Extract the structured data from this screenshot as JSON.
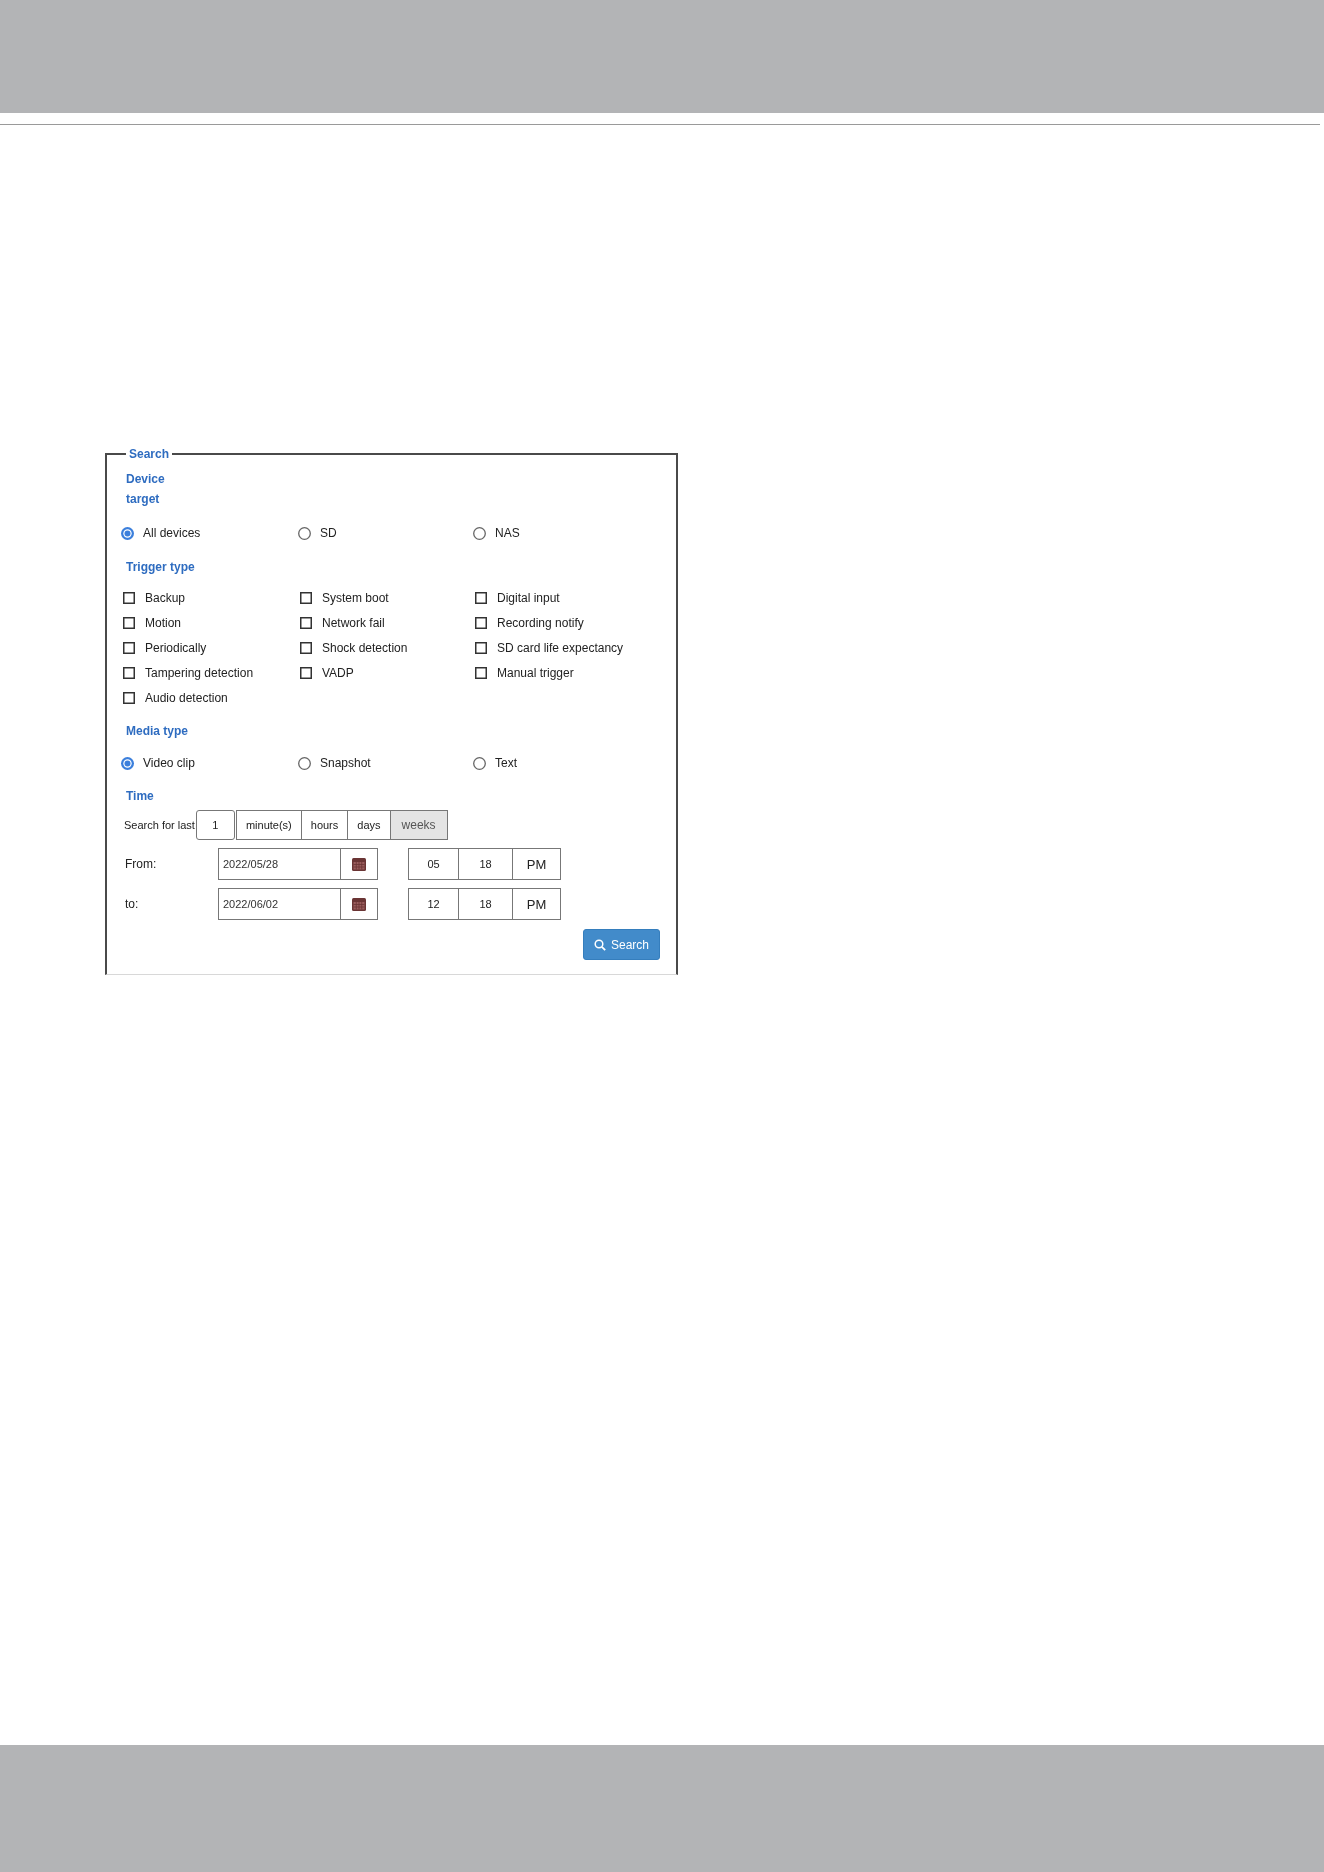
{
  "search_panel": {
    "legend": "Search",
    "device_target": {
      "label": "Device target",
      "options": [
        {
          "label": "All devices",
          "selected": true
        },
        {
          "label": "SD",
          "selected": false
        },
        {
          "label": "NAS",
          "selected": false
        }
      ]
    },
    "trigger_type": {
      "label": "Trigger type",
      "options": [
        {
          "label": "Backup",
          "checked": false
        },
        {
          "label": "System boot",
          "checked": false
        },
        {
          "label": "Digital input",
          "checked": false
        },
        {
          "label": "Motion",
          "checked": false
        },
        {
          "label": "Network fail",
          "checked": false
        },
        {
          "label": "Recording notify",
          "checked": false
        },
        {
          "label": "Periodically",
          "checked": false
        },
        {
          "label": "Shock detection",
          "checked": false
        },
        {
          "label": "SD card life expectancy",
          "checked": false
        },
        {
          "label": "Tampering detection",
          "checked": false
        },
        {
          "label": "VADP",
          "checked": false
        },
        {
          "label": "Manual trigger",
          "checked": false
        },
        {
          "label": "Audio detection",
          "checked": false
        }
      ]
    },
    "media_type": {
      "label": "Media type",
      "options": [
        {
          "label": "Video clip",
          "selected": true
        },
        {
          "label": "Snapshot",
          "selected": false
        },
        {
          "label": "Text",
          "selected": false
        }
      ]
    },
    "time": {
      "label": "Time",
      "search_for_last": {
        "label": "Search for last",
        "value": "1",
        "units": [
          {
            "label": "minute(s)",
            "selected": false
          },
          {
            "label": "hours",
            "selected": false
          },
          {
            "label": "days",
            "selected": false
          },
          {
            "label": "weeks",
            "selected": true
          }
        ]
      },
      "ranges": [
        {
          "label": "From:",
          "date": "2022/05/28",
          "hour": "05",
          "minute": "18",
          "period": "PM"
        },
        {
          "label": "to:",
          "date": "2022/06/02",
          "hour": "12",
          "minute": "18",
          "period": "PM"
        }
      ]
    },
    "search_button": "Search"
  }
}
